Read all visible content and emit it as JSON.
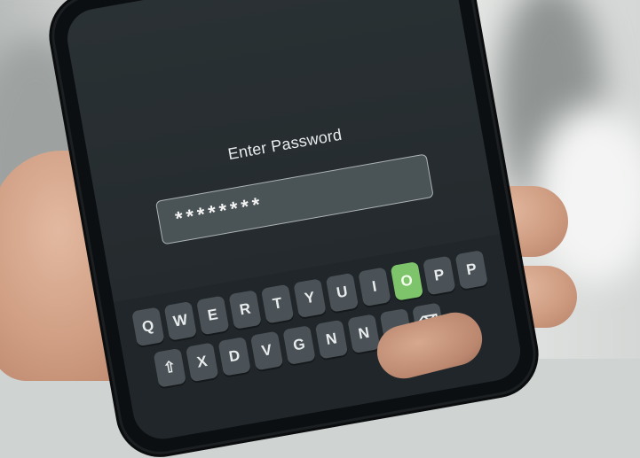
{
  "screen": {
    "title": "Enter Password",
    "password_masked": "********"
  },
  "keyboard": {
    "row1": [
      "Q",
      "W",
      "E",
      "R",
      "T",
      "Y",
      "U",
      "I",
      "O",
      "P",
      "P"
    ],
    "row2": [
      "⇧",
      "X",
      "D",
      "V",
      "G",
      "N",
      "N",
      "",
      "⌫"
    ],
    "active_key": "O"
  },
  "colors": {
    "screen_bg": "#252b2e",
    "key_bg": "#4a5257",
    "active_key": "#7ec46a"
  }
}
